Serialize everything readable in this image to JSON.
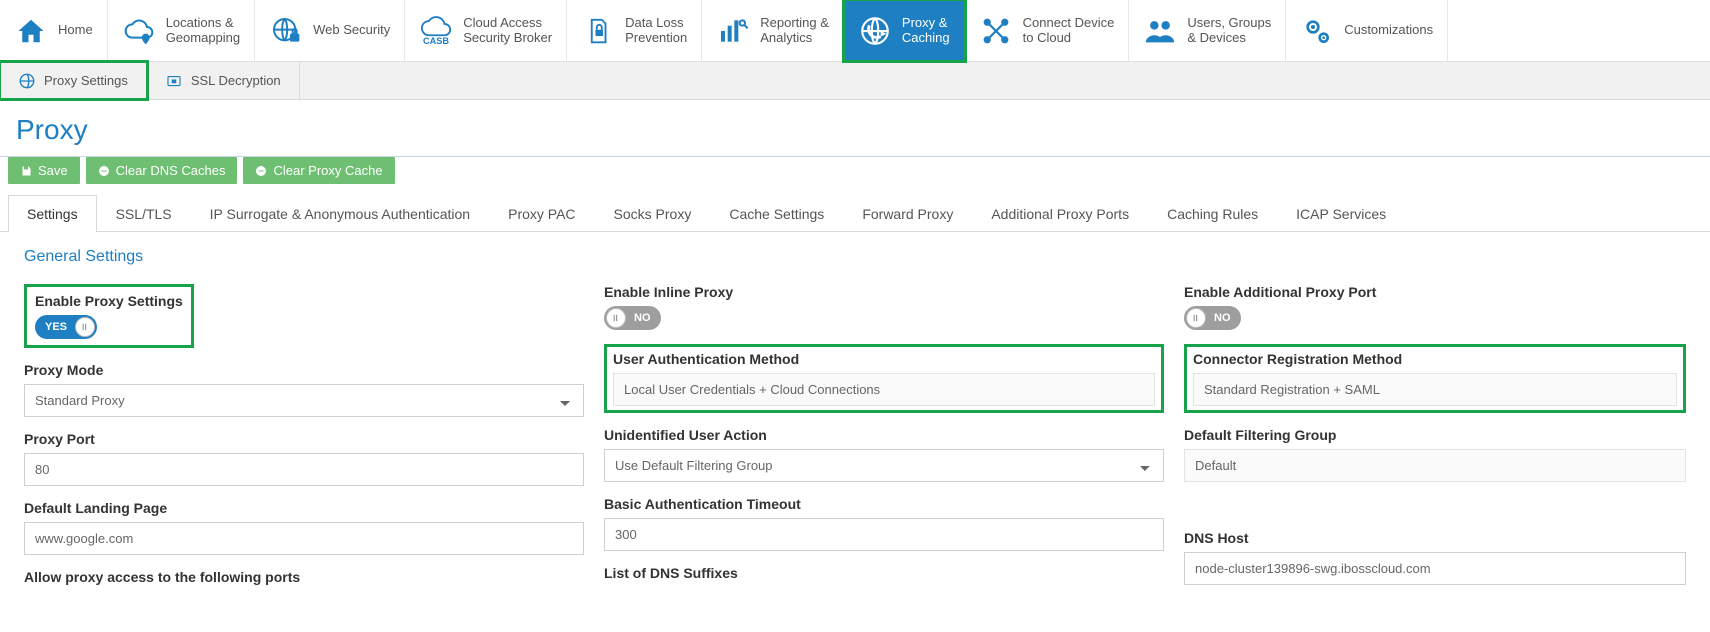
{
  "nav": {
    "items": [
      {
        "l1": "Home",
        "l2": ""
      },
      {
        "l1": "Locations &",
        "l2": "Geomapping"
      },
      {
        "l1": "Web Security",
        "l2": ""
      },
      {
        "l1": "Cloud Access",
        "l2": "Security Broker"
      },
      {
        "l1": "Data Loss",
        "l2": "Prevention"
      },
      {
        "l1": "Reporting &",
        "l2": "Analytics"
      },
      {
        "l1": "Proxy &",
        "l2": "Caching"
      },
      {
        "l1": "Connect Device",
        "l2": "to Cloud"
      },
      {
        "l1": "Users, Groups",
        "l2": "& Devices"
      },
      {
        "l1": "Customizations",
        "l2": ""
      }
    ]
  },
  "subnav": {
    "a": "Proxy Settings",
    "b": "SSL Decryption"
  },
  "page": {
    "title": "Proxy"
  },
  "actions": {
    "save": "Save",
    "clear_dns": "Clear DNS Caches",
    "clear_proxy": "Clear Proxy Cache"
  },
  "tabs": [
    "Settings",
    "SSL/TLS",
    "IP Surrogate & Anonymous Authentication",
    "Proxy PAC",
    "Socks Proxy",
    "Cache Settings",
    "Forward Proxy",
    "Additional Proxy Ports",
    "Caching Rules",
    "ICAP Services"
  ],
  "section": {
    "title": "General Settings"
  },
  "col1": {
    "enable_label": "Enable Proxy Settings",
    "enable_state": "YES",
    "mode_label": "Proxy Mode",
    "mode_value": "Standard Proxy",
    "port_label": "Proxy Port",
    "port_value": "80",
    "landing_label": "Default Landing Page",
    "landing_value": "www.google.com",
    "allow_label": "Allow proxy access to the following ports"
  },
  "col2": {
    "inline_label": "Enable Inline Proxy",
    "inline_state": "NO",
    "auth_label": "User Authentication Method",
    "auth_value": "Local User Credentials + Cloud Connections",
    "unid_label": "Unidentified User Action",
    "unid_value": "Use Default Filtering Group",
    "basic_label": "Basic Authentication Timeout",
    "basic_value": "300",
    "dns_label": "List of DNS Suffixes"
  },
  "col3": {
    "addl_label": "Enable Additional Proxy Port",
    "addl_state": "NO",
    "conn_label": "Connector Registration Method",
    "conn_value": "Standard Registration + SAML",
    "filt_label": "Default Filtering Group",
    "filt_value": "Default",
    "host_label": "DNS Host",
    "host_value": "node-cluster139896-swg.ibosscloud.com"
  }
}
